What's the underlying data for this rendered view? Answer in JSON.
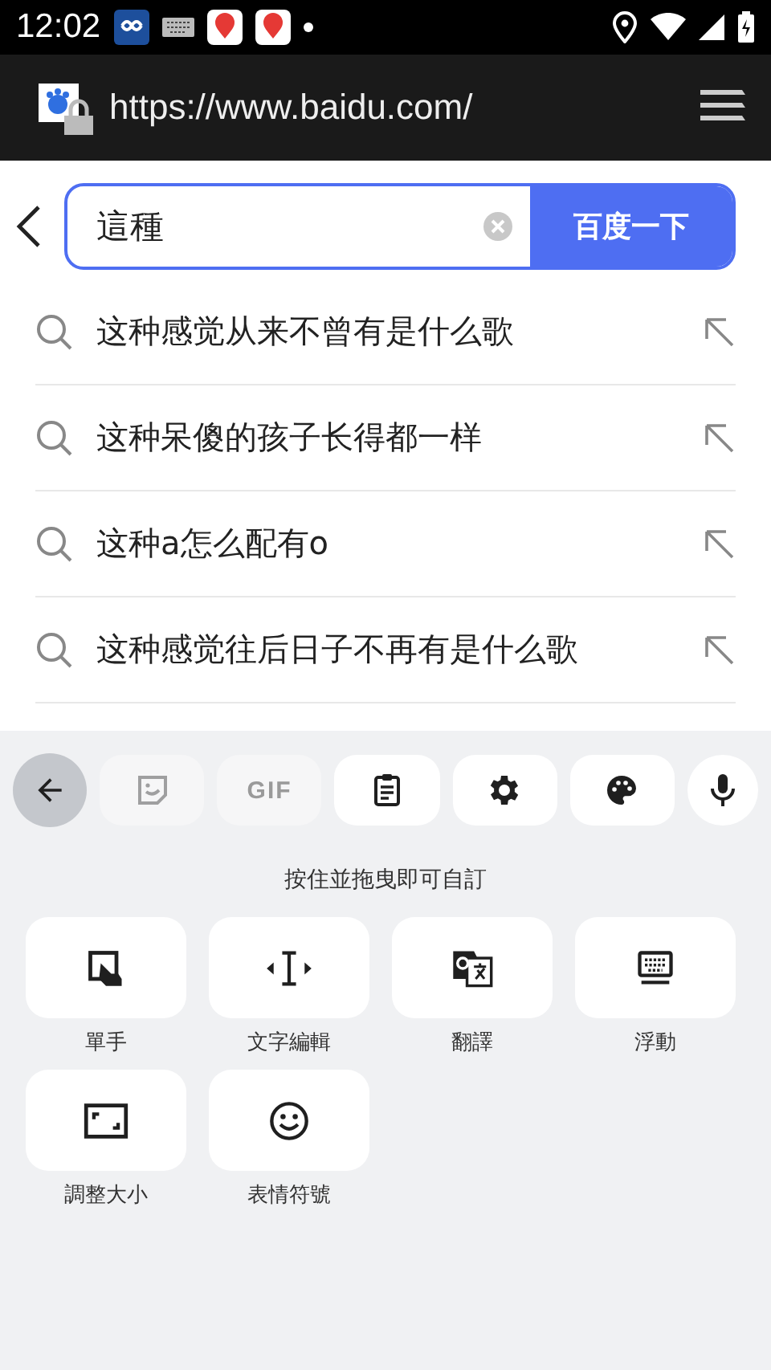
{
  "status_bar": {
    "time": "12:02"
  },
  "browser": {
    "url": "https://www.baidu.com/"
  },
  "search": {
    "value": "這種",
    "button": "百度一下"
  },
  "suggestions": [
    {
      "text": "这种感觉从来不曾有是什么歌"
    },
    {
      "text": "这种呆傻的孩子长得都一样"
    },
    {
      "text": "这种a怎么配有o"
    },
    {
      "text": "这种感觉往后日子不再有是什么歌"
    }
  ],
  "keyboard": {
    "toolbar": [
      {
        "kind": "back",
        "selected": true,
        "disabled": false
      },
      {
        "kind": "sticker",
        "selected": false,
        "disabled": true
      },
      {
        "kind": "gif",
        "label": "GIF",
        "selected": false,
        "disabled": true
      },
      {
        "kind": "clipboard",
        "selected": false,
        "disabled": false
      },
      {
        "kind": "settings",
        "selected": false,
        "disabled": false
      },
      {
        "kind": "palette",
        "selected": false,
        "disabled": false
      },
      {
        "kind": "mic",
        "selected": false,
        "disabled": false
      }
    ],
    "hint": "按住並拖曳即可自訂",
    "tiles": [
      {
        "kind": "one-hand",
        "label": "單手"
      },
      {
        "kind": "text-edit",
        "label": "文字編輯"
      },
      {
        "kind": "translate",
        "label": "翻譯"
      },
      {
        "kind": "floating",
        "label": "浮動"
      },
      {
        "kind": "resize",
        "label": "調整大小"
      },
      {
        "kind": "emoji",
        "label": "表情符號"
      }
    ]
  }
}
